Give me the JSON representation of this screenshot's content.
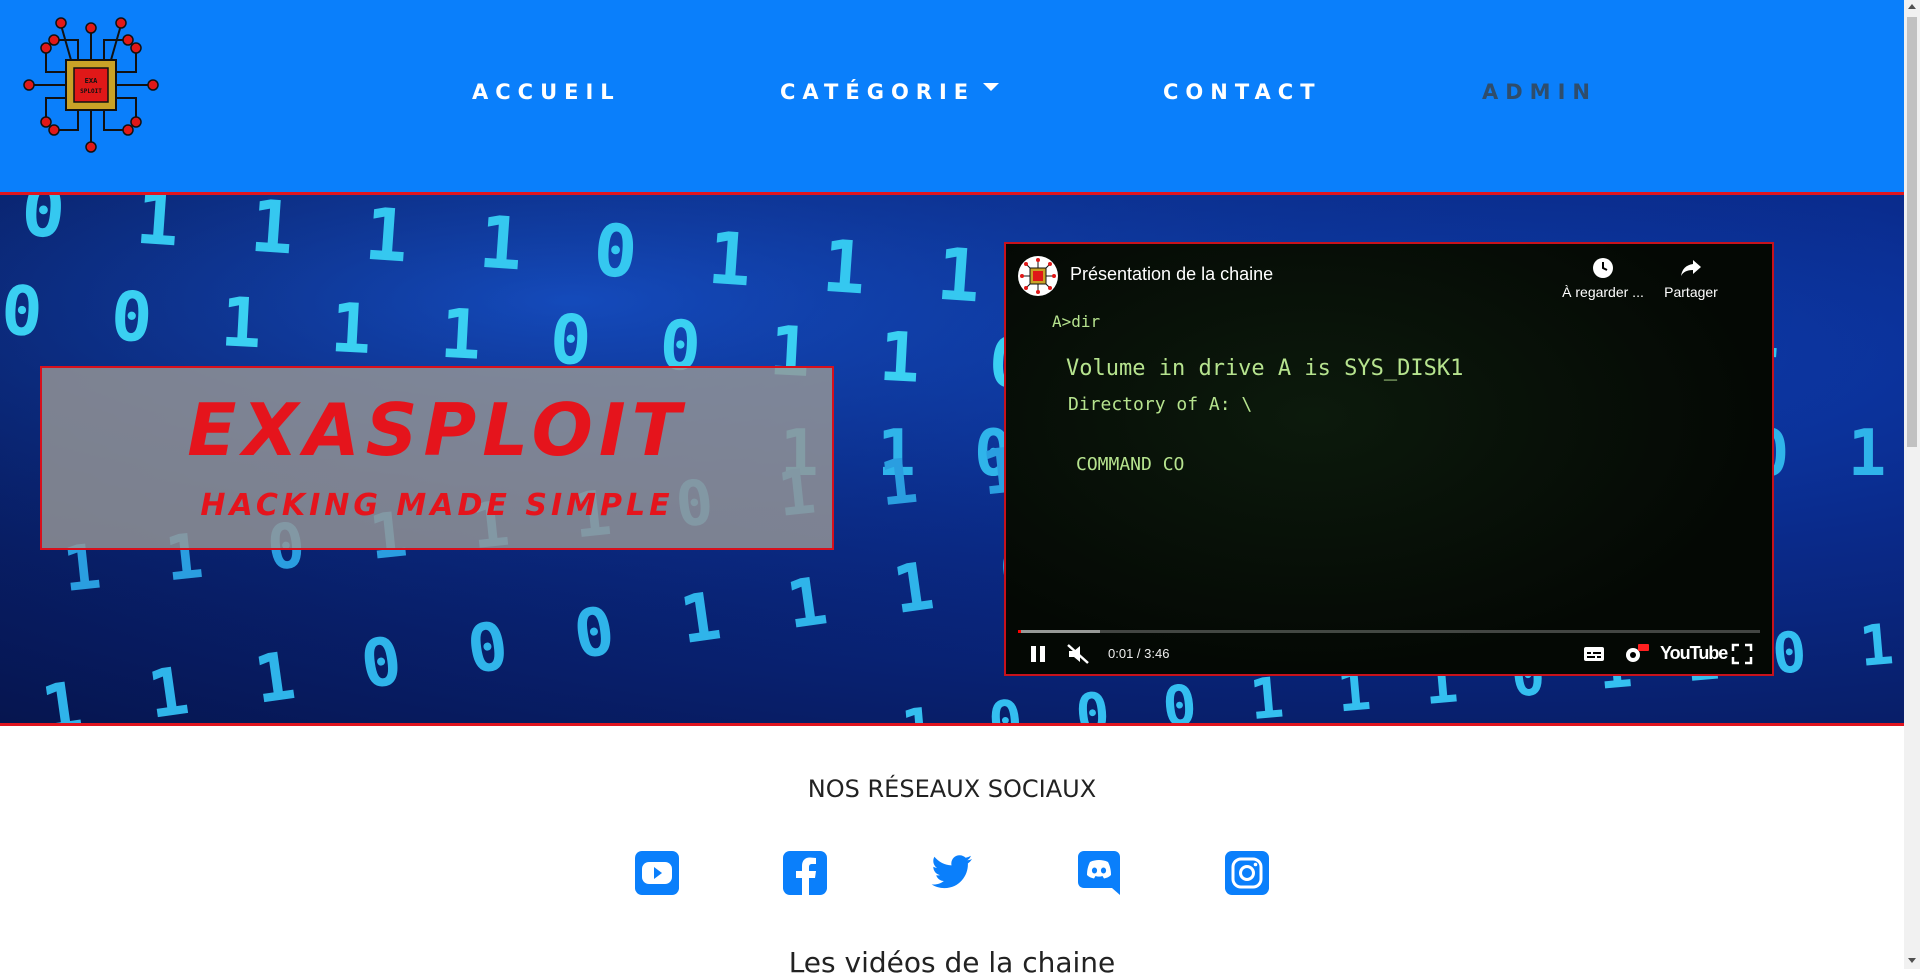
{
  "nav": {
    "items": [
      {
        "label": "ACCUEIL"
      },
      {
        "label": "CATÉGORIE"
      },
      {
        "label": "CONTACT"
      },
      {
        "label": "ADMIN"
      }
    ],
    "logo_text": "EXA SPLOIT",
    "logo_icon": "circuit-chip-icon"
  },
  "hero": {
    "title": "EXASPLOIT",
    "subtitle": "HACKING MADE SIMPLE",
    "binary_rows": [
      "0 1 1 1 1 0 1 1 1 1 1 1 0 1 1 1",
      "0 0 1 1 1 0 0 1 1 0 0 0 0 0",
      "1 1 0 1 1 1 0 1 1 1 0 1",
      "0 1 1 0 1 1 1 0 1 1 1 1 0 1",
      "1 1 1 0 0 0 1 1 1 0 1 1 1",
      "1 0 0 0 1 1 1 0 1 1 0 1 1 1"
    ]
  },
  "video": {
    "title": "Présentation de la chaine",
    "watch_later": "À regarder ...",
    "share": "Partager",
    "time": "0:01 / 3:46",
    "progress_fraction": 0.0044,
    "buffer_fraction": 0.11,
    "brand": "YouTube",
    "terminal": {
      "prompt": "A>dir",
      "line1": "Volume in drive A is SYS_DISK1",
      "line2": "Directory of A:   \\",
      "line3": "COMMAND  CO"
    }
  },
  "social": {
    "heading": "NOS RÉSEAUX SOCIAUX",
    "accent": "#0a7ffb",
    "icons": [
      "youtube-icon",
      "facebook-icon",
      "twitter-icon",
      "discord-icon",
      "instagram-icon"
    ]
  },
  "videos_heading": "Les vidéos de la chaine",
  "colors": {
    "nav_bg": "#0a7ffb",
    "brand_red": "#e5141c",
    "admin_text": "#2f4d6c"
  }
}
